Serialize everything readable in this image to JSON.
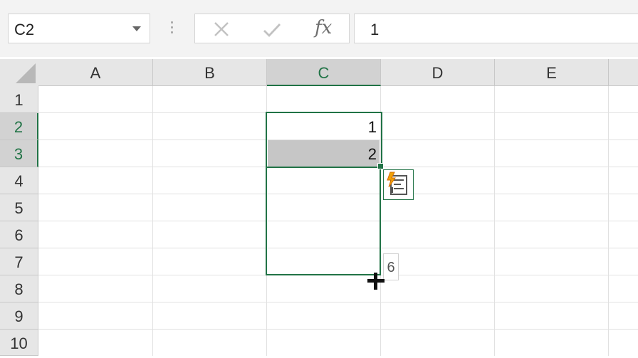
{
  "formula_bar": {
    "name_box": "C2",
    "cancel_icon": "cancel-x-icon",
    "enter_icon": "checkmark-icon",
    "fx_label": "fx",
    "formula_value": "1"
  },
  "columns": [
    "A",
    "B",
    "C",
    "D",
    "E"
  ],
  "rows": [
    "1",
    "2",
    "3",
    "4",
    "5",
    "6",
    "7",
    "8",
    "9",
    "10"
  ],
  "cells": {
    "C2": "1",
    "C3": "2"
  },
  "fill_tooltip": "6",
  "autofill_icon": "auto-fill-options-icon",
  "colors": {
    "accent": "#217346",
    "header_bg": "#e6e6e6",
    "selected_header_bg": "#d2d2d2"
  }
}
